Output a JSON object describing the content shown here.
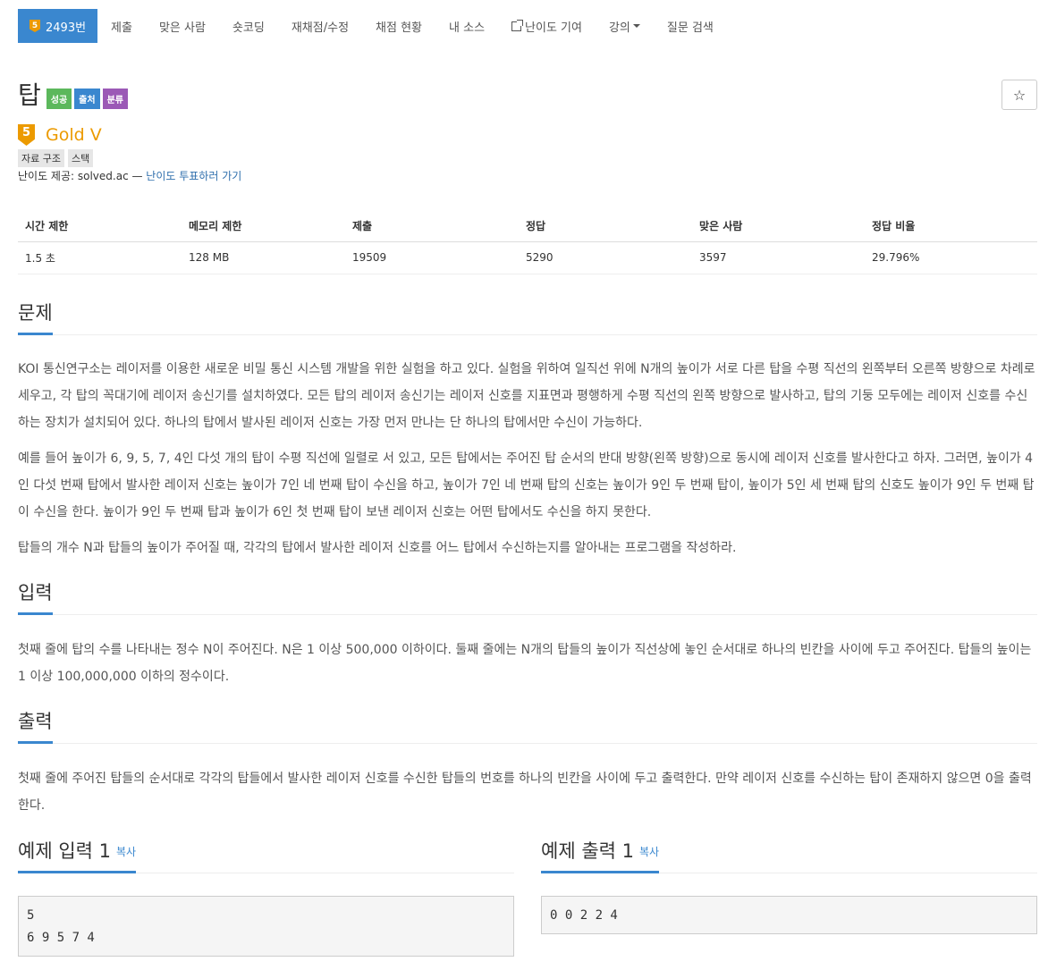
{
  "nav": {
    "problem_id": "2493번",
    "tier_digit": "5",
    "items": [
      "제출",
      "맞은 사람",
      "숏코딩",
      "재채점/수정",
      "채점 현황",
      "내 소스",
      "난이도 기여",
      "강의",
      "질문 검색"
    ]
  },
  "problem": {
    "title": "탑",
    "labels": [
      "성공",
      "출처",
      "분류"
    ],
    "star": "☆",
    "tier_digit": "5",
    "tier": "Gold V",
    "tags": [
      "자료 구조",
      "스택"
    ],
    "credit_prefix": "난이도 제공: solved.ac — ",
    "credit_link": "난이도 투표하러 가기"
  },
  "stats": {
    "headers": [
      "시간 제한",
      "메모리 제한",
      "제출",
      "정답",
      "맞은 사람",
      "정답 비율"
    ],
    "values": [
      "1.5 초",
      "128 MB",
      "19509",
      "5290",
      "3597",
      "29.796%"
    ]
  },
  "sections": {
    "problem_title": "문제",
    "problem_p1": "KOI 통신연구소는 레이저를 이용한 새로운 비밀 통신 시스템 개발을 위한 실험을 하고 있다. 실험을 위하여 일직선 위에 N개의 높이가 서로 다른 탑을 수평 직선의 왼쪽부터 오른쪽 방향으로 차례로 세우고, 각 탑의 꼭대기에 레이저 송신기를 설치하였다. 모든 탑의 레이저 송신기는 레이저 신호를 지표면과 평행하게 수평 직선의 왼쪽 방향으로 발사하고, 탑의 기둥 모두에는 레이저 신호를 수신하는 장치가 설치되어 있다. 하나의 탑에서 발사된 레이저 신호는 가장 먼저 만나는 단 하나의 탑에서만 수신이 가능하다.",
    "problem_p2": "예를 들어 높이가 6, 9, 5, 7, 4인 다섯 개의 탑이 수평 직선에 일렬로 서 있고, 모든 탑에서는 주어진 탑 순서의 반대 방향(왼쪽 방향)으로 동시에 레이저 신호를 발사한다고 하자. 그러면, 높이가 4인 다섯 번째 탑에서 발사한 레이저 신호는 높이가 7인 네 번째 탑이 수신을 하고, 높이가 7인 네 번째 탑의 신호는 높이가 9인 두 번째 탑이, 높이가 5인 세 번째 탑의 신호도 높이가 9인 두 번째 탑이 수신을 한다. 높이가 9인 두 번째 탑과 높이가 6인 첫 번째 탑이 보낸 레이저 신호는 어떤 탑에서도 수신을 하지 못한다.",
    "problem_p3": "탑들의 개수 N과 탑들의 높이가 주어질 때, 각각의 탑에서 발사한 레이저 신호를 어느 탑에서 수신하는지를 알아내는 프로그램을 작성하라.",
    "input_title": "입력",
    "input_p": "첫째 줄에 탑의 수를 나타내는 정수 N이 주어진다. N은 1 이상 500,000 이하이다. 둘째 줄에는 N개의 탑들의 높이가 직선상에 놓인 순서대로 하나의 빈칸을 사이에 두고 주어진다. 탑들의 높이는 1 이상 100,000,000 이하의 정수이다.",
    "output_title": "출력",
    "output_p": "첫째 줄에 주어진 탑들의 순서대로 각각의 탑들에서 발사한 레이저 신호를 수신한 탑들의 번호를 하나의 빈칸을 사이에 두고 출력한다. 만약 레이저 신호를 수신하는 탑이 존재하지 않으면 0을 출력한다."
  },
  "samples": {
    "input_title": "예제 입력 1",
    "output_title": "예제 출력 1",
    "copy": "복사",
    "input_text": "5\n6 9 5 7 4",
    "output_text": "0 0 2 2 4"
  }
}
